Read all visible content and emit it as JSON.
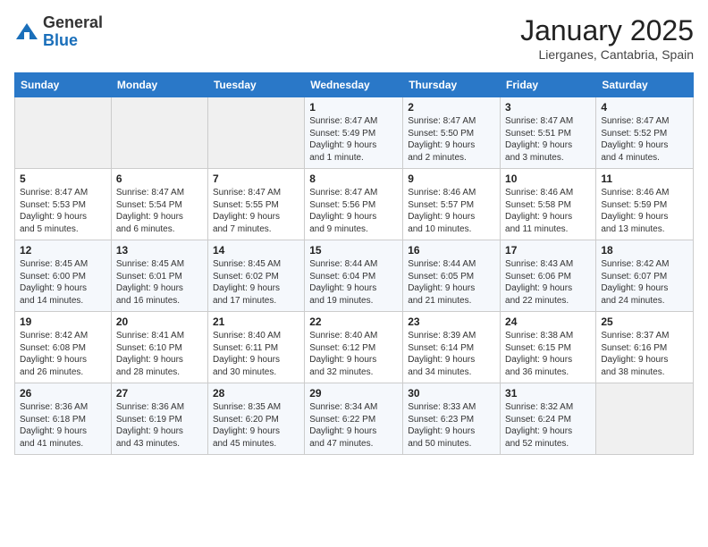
{
  "header": {
    "logo_general": "General",
    "logo_blue": "Blue",
    "month_title": "January 2025",
    "location": "Lierganes, Cantabria, Spain"
  },
  "days_of_week": [
    "Sunday",
    "Monday",
    "Tuesday",
    "Wednesday",
    "Thursday",
    "Friday",
    "Saturday"
  ],
  "weeks": [
    [
      {
        "day": "",
        "info": ""
      },
      {
        "day": "",
        "info": ""
      },
      {
        "day": "",
        "info": ""
      },
      {
        "day": "1",
        "info": "Sunrise: 8:47 AM\nSunset: 5:49 PM\nDaylight: 9 hours\nand 1 minute."
      },
      {
        "day": "2",
        "info": "Sunrise: 8:47 AM\nSunset: 5:50 PM\nDaylight: 9 hours\nand 2 minutes."
      },
      {
        "day": "3",
        "info": "Sunrise: 8:47 AM\nSunset: 5:51 PM\nDaylight: 9 hours\nand 3 minutes."
      },
      {
        "day": "4",
        "info": "Sunrise: 8:47 AM\nSunset: 5:52 PM\nDaylight: 9 hours\nand 4 minutes."
      }
    ],
    [
      {
        "day": "5",
        "info": "Sunrise: 8:47 AM\nSunset: 5:53 PM\nDaylight: 9 hours\nand 5 minutes."
      },
      {
        "day": "6",
        "info": "Sunrise: 8:47 AM\nSunset: 5:54 PM\nDaylight: 9 hours\nand 6 minutes."
      },
      {
        "day": "7",
        "info": "Sunrise: 8:47 AM\nSunset: 5:55 PM\nDaylight: 9 hours\nand 7 minutes."
      },
      {
        "day": "8",
        "info": "Sunrise: 8:47 AM\nSunset: 5:56 PM\nDaylight: 9 hours\nand 9 minutes."
      },
      {
        "day": "9",
        "info": "Sunrise: 8:46 AM\nSunset: 5:57 PM\nDaylight: 9 hours\nand 10 minutes."
      },
      {
        "day": "10",
        "info": "Sunrise: 8:46 AM\nSunset: 5:58 PM\nDaylight: 9 hours\nand 11 minutes."
      },
      {
        "day": "11",
        "info": "Sunrise: 8:46 AM\nSunset: 5:59 PM\nDaylight: 9 hours\nand 13 minutes."
      }
    ],
    [
      {
        "day": "12",
        "info": "Sunrise: 8:45 AM\nSunset: 6:00 PM\nDaylight: 9 hours\nand 14 minutes."
      },
      {
        "day": "13",
        "info": "Sunrise: 8:45 AM\nSunset: 6:01 PM\nDaylight: 9 hours\nand 16 minutes."
      },
      {
        "day": "14",
        "info": "Sunrise: 8:45 AM\nSunset: 6:02 PM\nDaylight: 9 hours\nand 17 minutes."
      },
      {
        "day": "15",
        "info": "Sunrise: 8:44 AM\nSunset: 6:04 PM\nDaylight: 9 hours\nand 19 minutes."
      },
      {
        "day": "16",
        "info": "Sunrise: 8:44 AM\nSunset: 6:05 PM\nDaylight: 9 hours\nand 21 minutes."
      },
      {
        "day": "17",
        "info": "Sunrise: 8:43 AM\nSunset: 6:06 PM\nDaylight: 9 hours\nand 22 minutes."
      },
      {
        "day": "18",
        "info": "Sunrise: 8:42 AM\nSunset: 6:07 PM\nDaylight: 9 hours\nand 24 minutes."
      }
    ],
    [
      {
        "day": "19",
        "info": "Sunrise: 8:42 AM\nSunset: 6:08 PM\nDaylight: 9 hours\nand 26 minutes."
      },
      {
        "day": "20",
        "info": "Sunrise: 8:41 AM\nSunset: 6:10 PM\nDaylight: 9 hours\nand 28 minutes."
      },
      {
        "day": "21",
        "info": "Sunrise: 8:40 AM\nSunset: 6:11 PM\nDaylight: 9 hours\nand 30 minutes."
      },
      {
        "day": "22",
        "info": "Sunrise: 8:40 AM\nSunset: 6:12 PM\nDaylight: 9 hours\nand 32 minutes."
      },
      {
        "day": "23",
        "info": "Sunrise: 8:39 AM\nSunset: 6:14 PM\nDaylight: 9 hours\nand 34 minutes."
      },
      {
        "day": "24",
        "info": "Sunrise: 8:38 AM\nSunset: 6:15 PM\nDaylight: 9 hours\nand 36 minutes."
      },
      {
        "day": "25",
        "info": "Sunrise: 8:37 AM\nSunset: 6:16 PM\nDaylight: 9 hours\nand 38 minutes."
      }
    ],
    [
      {
        "day": "26",
        "info": "Sunrise: 8:36 AM\nSunset: 6:18 PM\nDaylight: 9 hours\nand 41 minutes."
      },
      {
        "day": "27",
        "info": "Sunrise: 8:36 AM\nSunset: 6:19 PM\nDaylight: 9 hours\nand 43 minutes."
      },
      {
        "day": "28",
        "info": "Sunrise: 8:35 AM\nSunset: 6:20 PM\nDaylight: 9 hours\nand 45 minutes."
      },
      {
        "day": "29",
        "info": "Sunrise: 8:34 AM\nSunset: 6:22 PM\nDaylight: 9 hours\nand 47 minutes."
      },
      {
        "day": "30",
        "info": "Sunrise: 8:33 AM\nSunset: 6:23 PM\nDaylight: 9 hours\nand 50 minutes."
      },
      {
        "day": "31",
        "info": "Sunrise: 8:32 AM\nSunset: 6:24 PM\nDaylight: 9 hours\nand 52 minutes."
      },
      {
        "day": "",
        "info": ""
      }
    ]
  ]
}
